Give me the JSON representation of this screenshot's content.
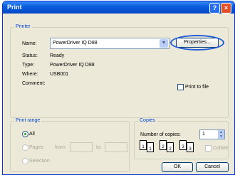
{
  "window": {
    "title": "Print",
    "help_label": "?",
    "close_label": "×"
  },
  "printer": {
    "group_label": "Printer",
    "name_label": "Name:",
    "name_value": "PowerDriver IQ D88",
    "properties_label": "Properties...",
    "status_label": "Status:",
    "status_value": "Ready",
    "type_label": "Type:",
    "type_value": "PowerDriver IQ D88",
    "where_label": "Where:",
    "where_value": "USB001",
    "comment_label": "Comment:",
    "print_to_file_label": "Print to file"
  },
  "print_range": {
    "group_label": "Print range",
    "all_label": "All",
    "pages_label": "Pages",
    "from_label": "from:",
    "to_label": "to:",
    "selection_label": "Selection"
  },
  "copies": {
    "group_label": "Copies",
    "number_label": "Number of copies:",
    "number_value": "1",
    "collate_label": "Collate",
    "page_numbers": [
      "1",
      "2",
      "3",
      "1",
      "2",
      "3"
    ]
  },
  "buttons": {
    "ok_label": "OK",
    "cancel_label": "Cancel"
  },
  "colors": {
    "accent": "#0046d5",
    "highlight_ring": "#1e5bd6"
  }
}
